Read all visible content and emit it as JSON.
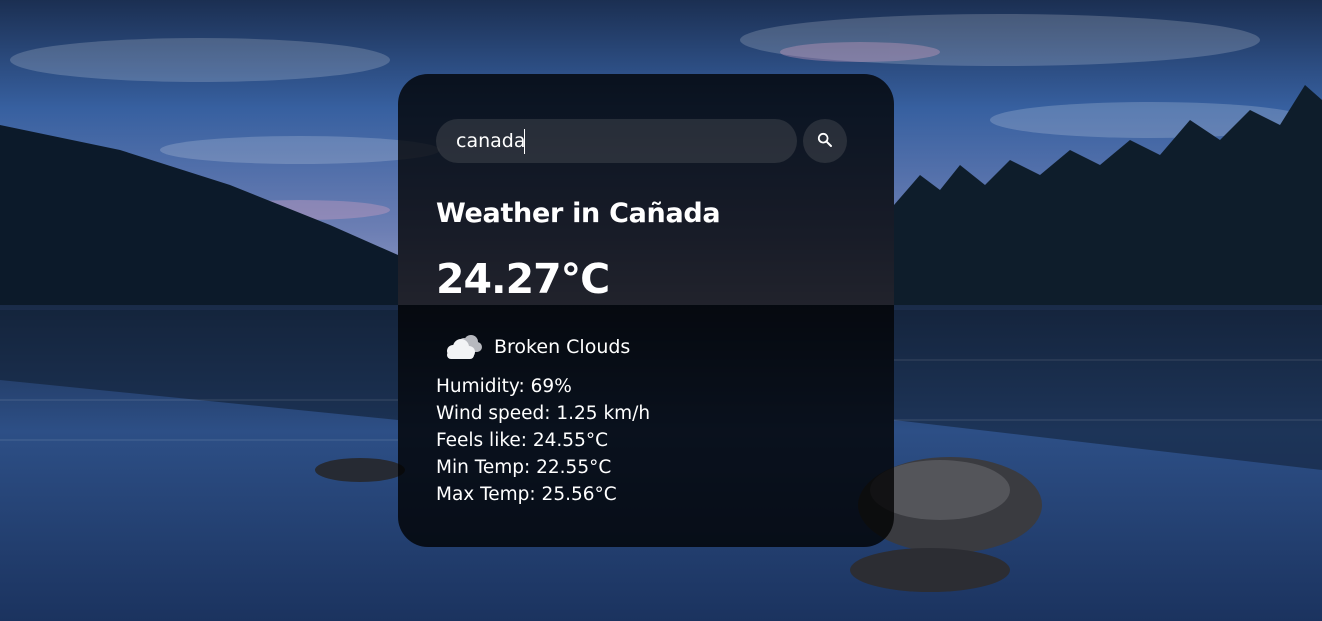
{
  "search": {
    "value": "canada",
    "placeholder": "Search"
  },
  "weather": {
    "city_heading": "Weather in Cañada",
    "temperature": "24.27°C",
    "icon": "broken-clouds-icon",
    "description": "Broken Clouds",
    "details": {
      "humidity": "Humidity: 69%",
      "wind_speed": "Wind speed: 1.25 km/h",
      "feels_like": "Feels like: 24.55°C",
      "min_temp": "Min Temp: 22.55°C",
      "max_temp": "Max Temp: 25.56°C"
    }
  },
  "colors": {
    "card_background": "#000000",
    "text": "#ffffff",
    "sky_top": "#1e3357",
    "water": "#203a66"
  }
}
